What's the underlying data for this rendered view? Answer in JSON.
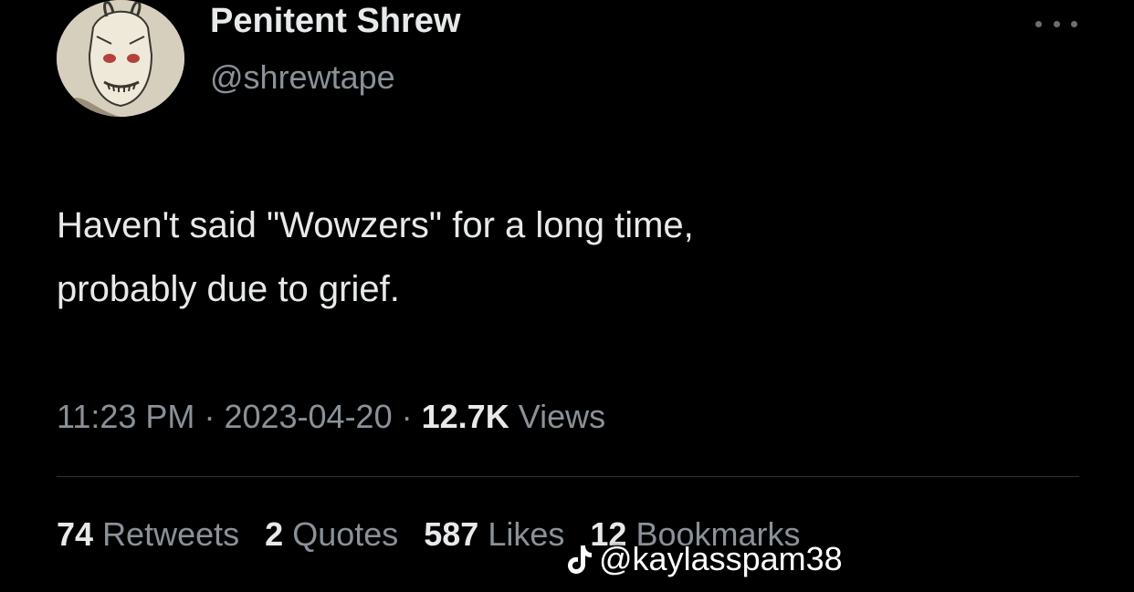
{
  "tweet": {
    "display_name": "Penitent Shrew",
    "handle": "@shrewtape",
    "text_line1": "Haven't said \"Wowzers\" for a long time,",
    "text_line2": "probably due to grief.",
    "time": "11:23 PM",
    "date": "2023-04-20",
    "separator": "·",
    "views_count": "12.7K",
    "views_label": "Views"
  },
  "stats": {
    "retweets_count": "74",
    "retweets_label": "Retweets",
    "quotes_count": "2",
    "quotes_label": "Quotes",
    "likes_count": "587",
    "likes_label": "Likes",
    "bookmarks_count": "12",
    "bookmarks_label": "Bookmarks"
  },
  "watermark": {
    "text": "@kaylasspam38",
    "icon": "tiktok-icon"
  },
  "icons": {
    "more": "more-options-icon",
    "avatar": "avatar"
  },
  "colors": {
    "background": "#000000",
    "primary_text": "#e7e9ea",
    "secondary_text": "#8b9198",
    "divider": "#2f3336"
  }
}
